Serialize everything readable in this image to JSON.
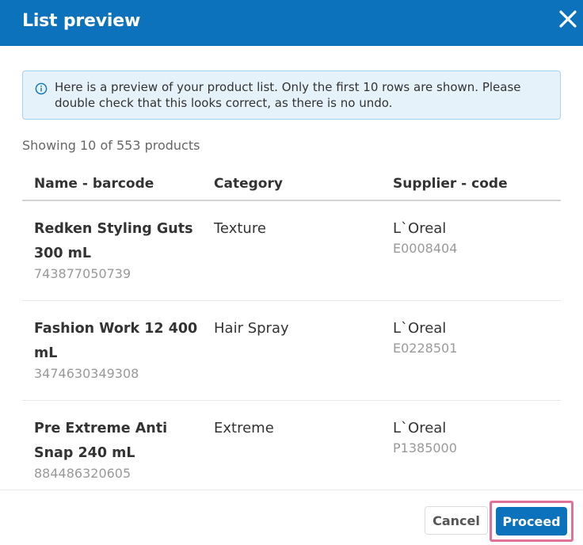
{
  "dialog": {
    "title": "List preview",
    "close_icon": "close-icon"
  },
  "info": {
    "icon": "info-icon",
    "accent": "#0d72bc",
    "message": "Here is a preview of your product list. Only the first 10 rows are shown. Please double check that this looks correct, as there is no undo."
  },
  "summary": "Showing 10 of 553 products",
  "table": {
    "headers": [
      "Name - barcode",
      "Category",
      "Supplier - code"
    ],
    "rows": [
      {
        "name": "Redken Styling Guts 300 mL",
        "barcode": "743877050739",
        "category": "Texture",
        "supplier": "L`Oreal",
        "code": "E0008404"
      },
      {
        "name": "Fashion Work 12 400 mL",
        "barcode": "3474630349308",
        "category": "Hair Spray",
        "supplier": "L`Oreal",
        "code": "E0228501"
      },
      {
        "name": "Pre Extreme Anti Snap 240 mL",
        "barcode": "884486320605",
        "category": "Extreme",
        "supplier": "L`Oreal",
        "code": "P1385000"
      }
    ]
  },
  "footer": {
    "cancel_label": "Cancel",
    "proceed_label": "Proceed",
    "highlight_color": "#e0729a"
  }
}
